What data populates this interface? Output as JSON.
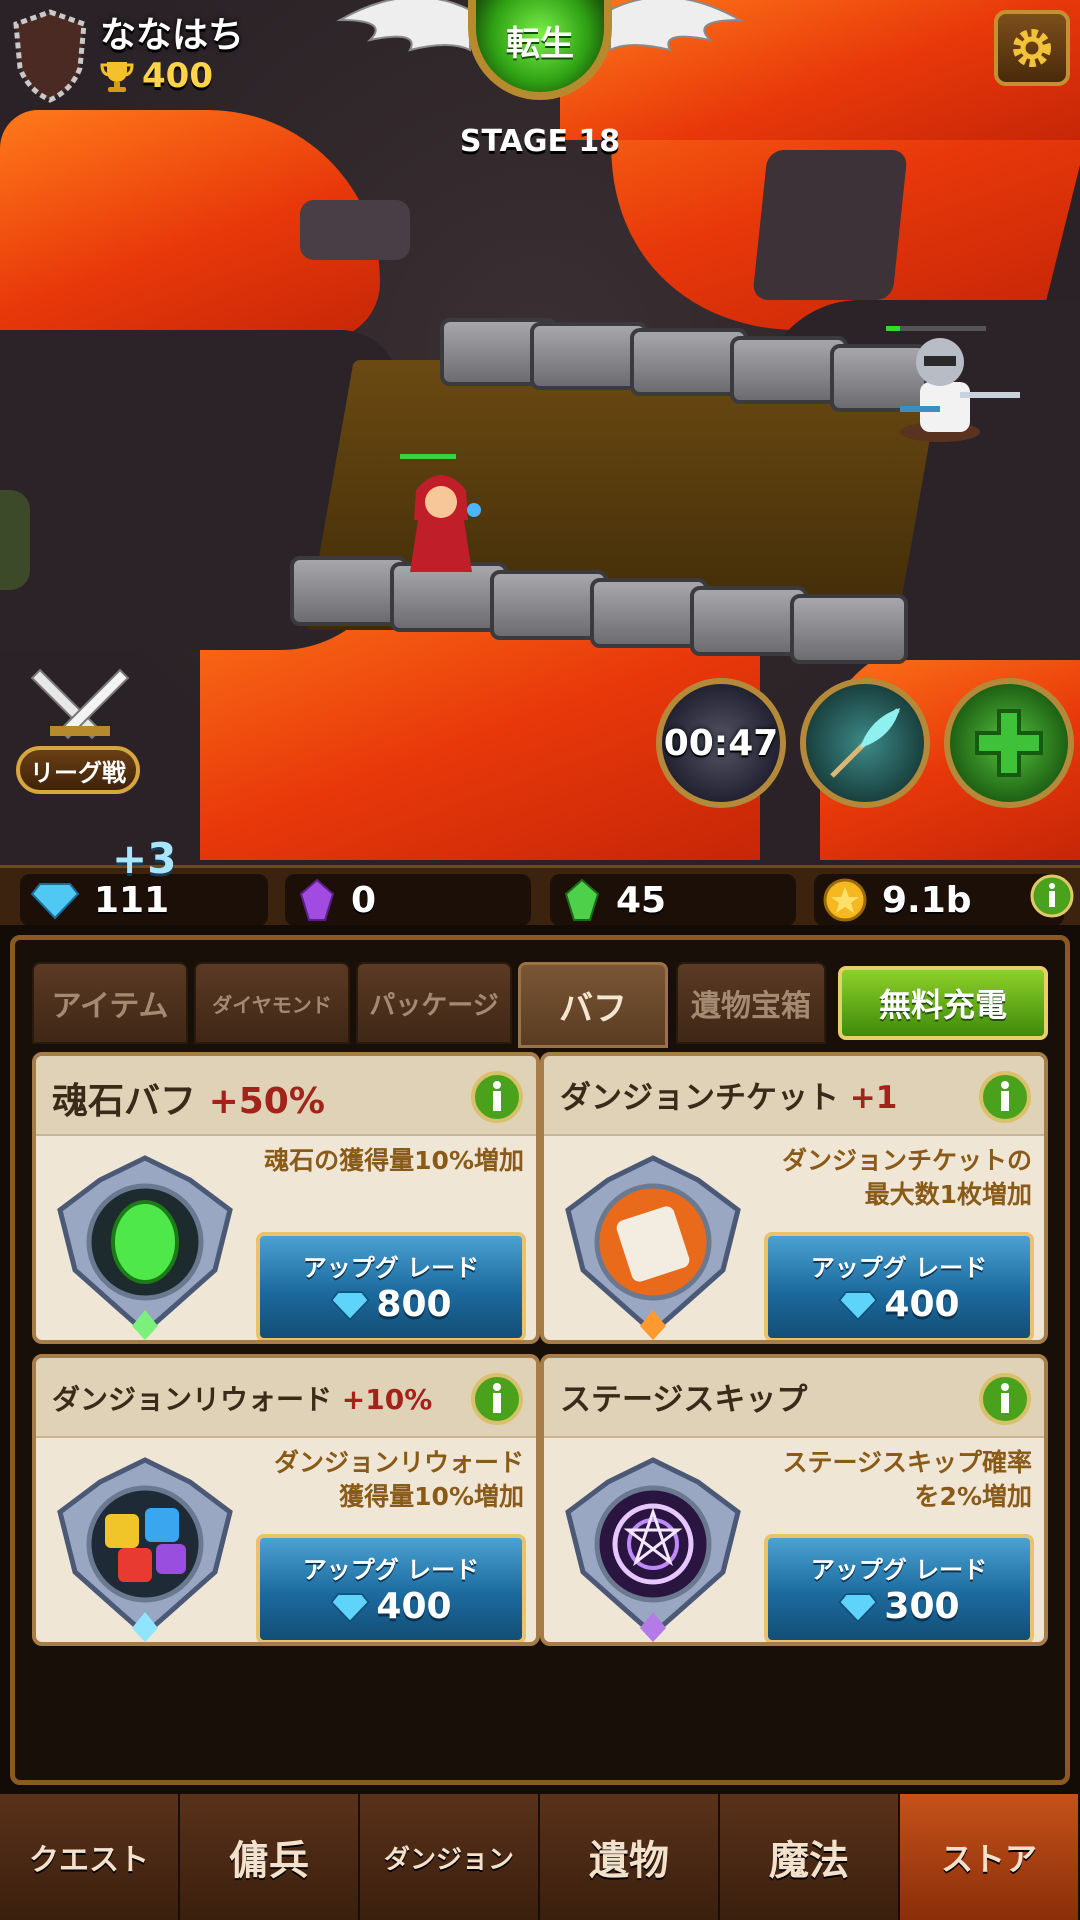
{
  "header": {
    "player_name": "ななはち",
    "trophy_score": "400",
    "rebirth_label": "転生",
    "stage_label": "STAGE 18"
  },
  "league": {
    "label": "リーグ戦"
  },
  "skills": {
    "timer": "00:47"
  },
  "currency": {
    "diamonds": "111",
    "diamond_gain": "+3",
    "soul_stones": "0",
    "green_gems": "45",
    "gold": "9.1b"
  },
  "store": {
    "tabs": [
      "アイテム",
      "ダイヤモンド",
      "パッケージ",
      "バフ",
      "遺物宝箱"
    ],
    "active_tab": "バフ",
    "free_charge": "無料充電",
    "upgrade_label": "アップグ レード",
    "cards": [
      {
        "title": "魂石バフ",
        "bonus": "+50%",
        "desc_lines": [
          "魂石の獲得量10%増加"
        ],
        "price": "800",
        "emblem": "soulstone-icon"
      },
      {
        "title": "ダンジョンチケット",
        "bonus": "+1",
        "desc_lines": [
          "ダンジョンチケットの",
          "最大数1枚増加"
        ],
        "price": "400",
        "emblem": "scroll-ticket-icon"
      },
      {
        "title": "ダンジョンリウォード",
        "bonus": "+10%",
        "desc_lines": [
          "ダンジョンリウォード",
          "獲得量10%増加"
        ],
        "price": "400",
        "emblem": "gem-cluster-icon"
      },
      {
        "title": "ステージスキップ",
        "bonus": "",
        "desc_lines": [
          "ステージスキップ確率",
          "を2%増加"
        ],
        "price": "300",
        "emblem": "magic-circle-icon"
      }
    ]
  },
  "nav": {
    "items": [
      "クエスト",
      "傭兵",
      "ダンジョン",
      "遺物",
      "魔法",
      "ストア"
    ],
    "active": "ストア"
  },
  "colors": {
    "accent_bonus": "#a3231b",
    "upgrade_blue": "#1c6a9e",
    "free_green": "#5aa81a",
    "active_nav": "#c5521a"
  }
}
